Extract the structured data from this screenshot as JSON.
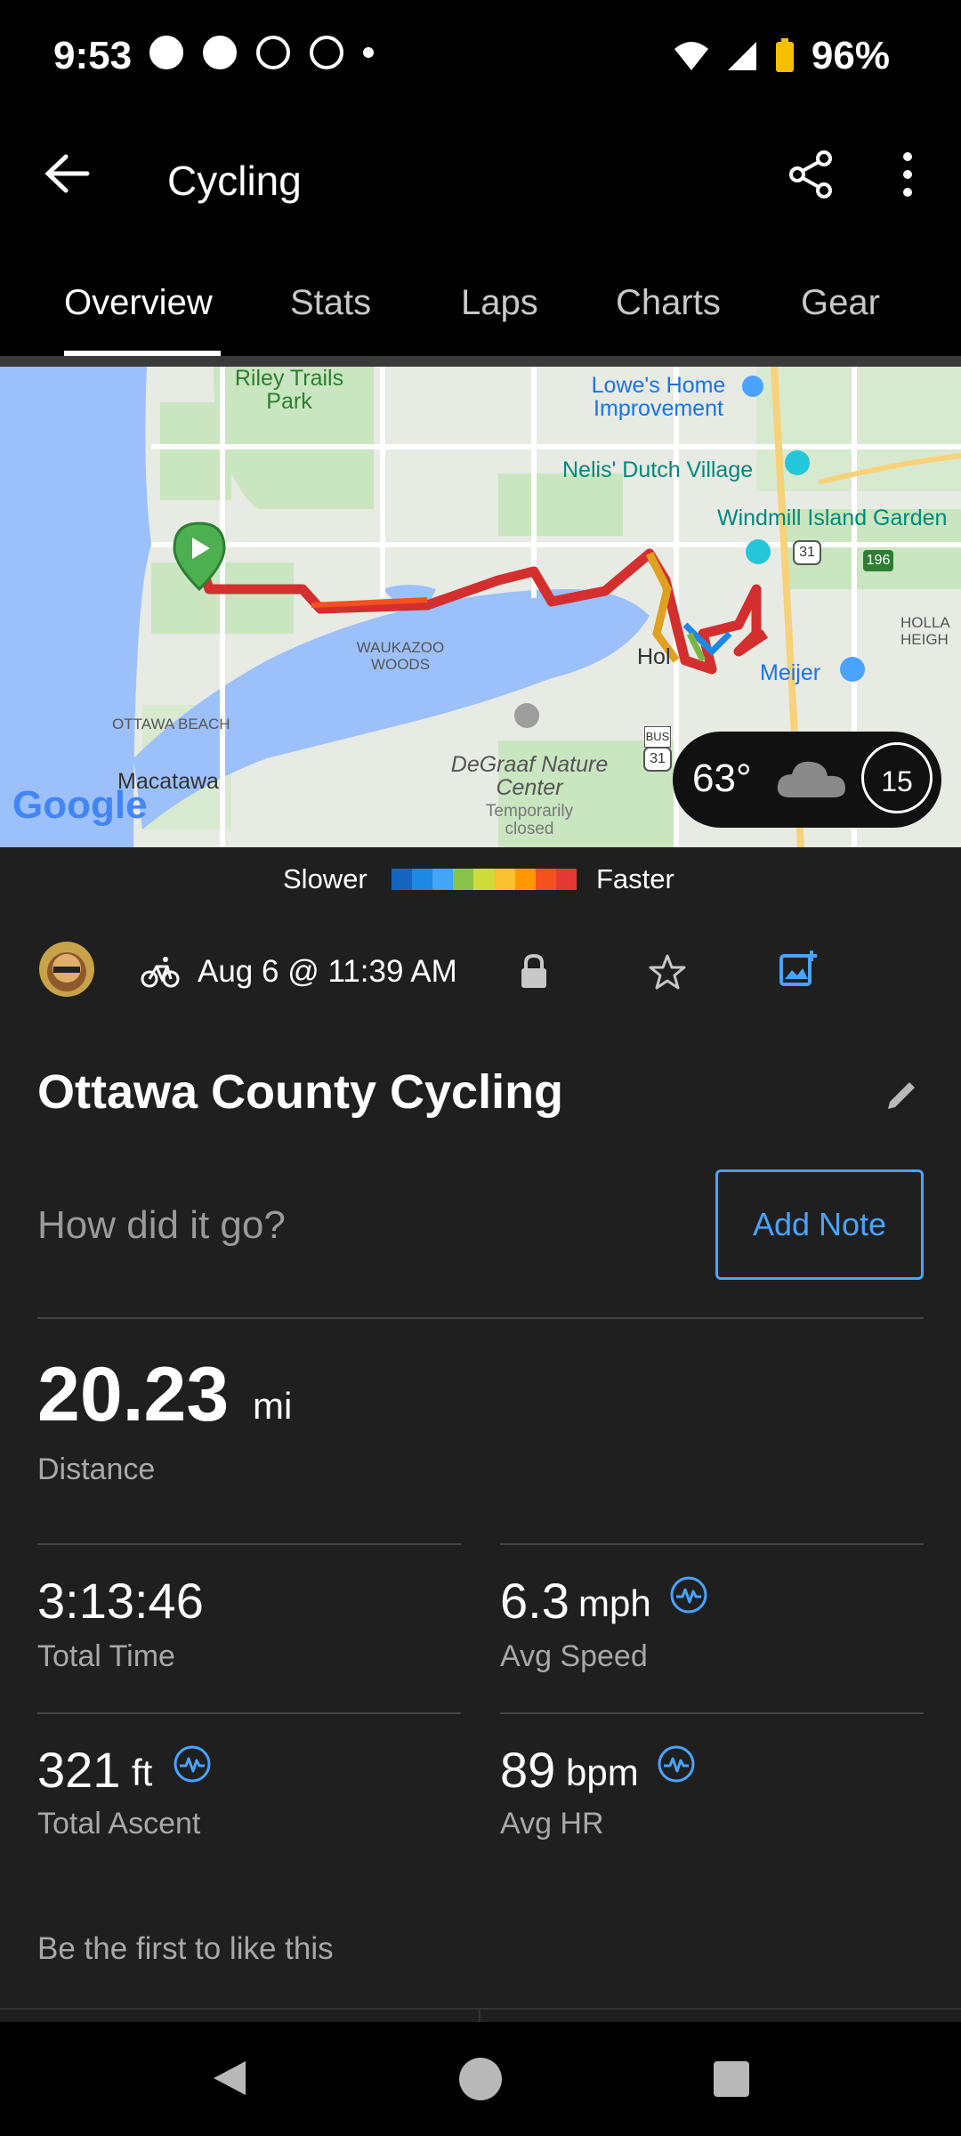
{
  "status_bar": {
    "time": "9:53",
    "battery": "96%"
  },
  "app_bar": {
    "title": "Cycling"
  },
  "tabs": [
    "Overview",
    "Stats",
    "Laps",
    "Charts",
    "Gear"
  ],
  "map": {
    "labels": {
      "riley": "Riley Trails Park",
      "lowes": "Lowe's Home Improvement",
      "nelis": "Nelis' Dutch Village",
      "windmill": "Windmill Island Garden",
      "holland": "HOLLA HEIGH",
      "meijer": "Meijer",
      "waukazoo": "WAUKAZOO WOODS",
      "ottawa": "OTTAWA BEACH",
      "macatawa": "Macatawa",
      "degraaf": "DeGraaf Nature Center",
      "degraaf_status": "Temporarily closed",
      "google": "Google",
      "hol": "Hol",
      "us31": "31",
      "us31b": "31",
      "bus": "BUS",
      "i196": "196"
    },
    "weather": {
      "temp": "63°",
      "wind": "15"
    }
  },
  "legend": {
    "slower": "Slower",
    "faster": "Faster",
    "colors": [
      "#1565c0",
      "#1e88e5",
      "#42a5f5",
      "#8bc34a",
      "#cddc39",
      "#fbc02d",
      "#ff9800",
      "#f4511e",
      "#e53935"
    ]
  },
  "activity": {
    "date": "Aug 6 @ 11:39 AM",
    "title": "Ottawa County Cycling",
    "note_prompt": "How did it go?",
    "add_note": "Add Note"
  },
  "stats": {
    "distance": {
      "value": "20.23",
      "unit": "mi",
      "label": "Distance"
    },
    "total_time": {
      "value": "3:13:46",
      "label": "Total Time"
    },
    "avg_speed": {
      "value": "6.3",
      "unit": "mph",
      "label": "Avg Speed"
    },
    "total_ascent": {
      "value": "321",
      "unit": "ft",
      "label": "Total Ascent"
    },
    "avg_hr": {
      "value": "89",
      "unit": "bpm",
      "label": "Avg HR"
    }
  },
  "social": {
    "likes_text": "Be the first to like this"
  },
  "colors": {
    "accent": "#4aa3ff",
    "background": "#1f1f1f",
    "route": "#d32f2f"
  }
}
